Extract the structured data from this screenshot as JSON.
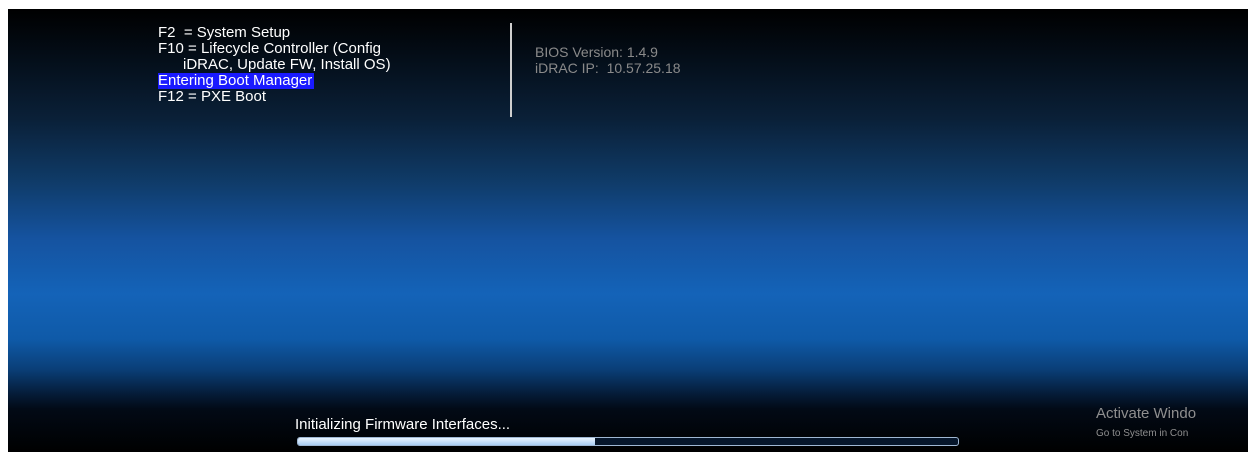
{
  "boot_menu": {
    "items": [
      "F2  = System Setup",
      "F10 = Lifecycle Controller (Config",
      "      iDRAC, Update FW, Install OS)",
      "Entering Boot Manager",
      "F12 = PXE Boot"
    ],
    "highlighted_index": 3
  },
  "system_info": {
    "bios_version": "BIOS Version: 1.4.9",
    "idrac_ip": "iDRAC IP:  10.57.25.18"
  },
  "status": {
    "text": "Initializing Firmware Interfaces...",
    "progress": 0.45
  },
  "watermark": {
    "title": "Activate Windo",
    "subtitle": "Go to System in Con"
  },
  "colors": {
    "highlight": "#1a1aff",
    "info_text": "#8a8a8a",
    "progress_fill": "#cfe3f9"
  }
}
